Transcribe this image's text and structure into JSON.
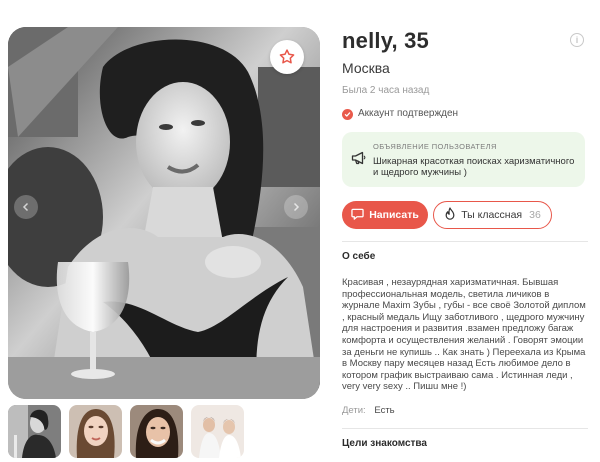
{
  "profile": {
    "name_age": "nelly, 35",
    "city": "Москва",
    "last_seen": "Была 2 часа назад",
    "verified": "Аккаунт подтвержден"
  },
  "ad": {
    "title": "ОБЪЯВЛЕНИЕ ПОЛЬЗОВАТЕЛЯ",
    "text": "Шикарная красоткая поисках харизматичного и щедрого мужчины )"
  },
  "actions": {
    "write_label": "Написать",
    "like_label": "Ты классная",
    "like_count": "36"
  },
  "about": {
    "title": "О себе",
    "text": "Красивая , незаурядная харизматичная. Бывшая профессиональная модель, светила личиков в журнале Maxim Зубы , губы - все своё Золотой диплом , красный медаль Ищу заботливого , щедрого мужчину для настроения и развития .взамен предложу багаж комфорта и осуществления желаний . Говорят эмоции за деньги не купишь .. Как знать ) Переехала из Крыма в Москву пару месяцев назад Есть любимое дело в котором график выстраиваю сама . Истинная леди , very very sexy .. Пишu мне !)"
  },
  "details": {
    "kids_label": "Дети:",
    "kids_value": "Есть"
  },
  "goals": {
    "title": "Цели знакомства"
  },
  "icons": {
    "favorite": "star-icon",
    "info": "info-icon",
    "ad": "megaphone-icon",
    "verified": "check-circle-icon",
    "write": "chat-icon",
    "like": "flame-icon",
    "nav_prev": "chevron-left-icon",
    "nav_next": "chevron-right-icon"
  },
  "colors": {
    "accent": "#e8574a",
    "ad_background": "#edf7ea",
    "muted_text": "#9a9a9a"
  },
  "gallery": {
    "thumbnail_count": 4
  }
}
